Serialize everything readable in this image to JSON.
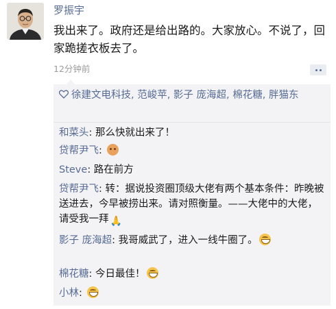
{
  "post": {
    "author": "罗振宇",
    "text": "我出来了。政府还是给出路的。大家放心。不说了，回家跪搓衣板去了。",
    "time": "12分钟前"
  },
  "likes": {
    "icon": "heart-icon",
    "text": "徐建文电科技, 范峻苹, 影子 庞海超, 棉花糖, 胖猫东"
  },
  "comments": [
    {
      "name": "和菜头",
      "text": ": 那么快就出来了！",
      "emoji": ""
    },
    {
      "name": "贷帮尹飞",
      "text": ": ",
      "emoji": "orange-face-emoji"
    },
    {
      "name": "Steve",
      "text": ": 路在前方",
      "emoji": ""
    },
    {
      "name": "贷帮尹飞",
      "text": ": 转：据说投资圈顶级大佬有两个基本条件：昨晚被送进去，今早被捞出来。请对照衡量。——大佬中的大佬，请受我一拜",
      "emoji": "praying-hands-emoji"
    },
    {
      "name": "影子 庞海超",
      "text": ": 我哥威武了，进入一线牛圈了。",
      "emoji": "grin-emoji"
    },
    {
      "name": "棉花糖",
      "text": ": 今日最佳！",
      "emoji": "grin-emoji"
    },
    {
      "name": "小林",
      "text": ": ",
      "emoji": "grin-emoji"
    }
  ],
  "colors": {
    "link": "#576b95",
    "panel": "#f3f3f5",
    "time": "#9b9b9b"
  }
}
